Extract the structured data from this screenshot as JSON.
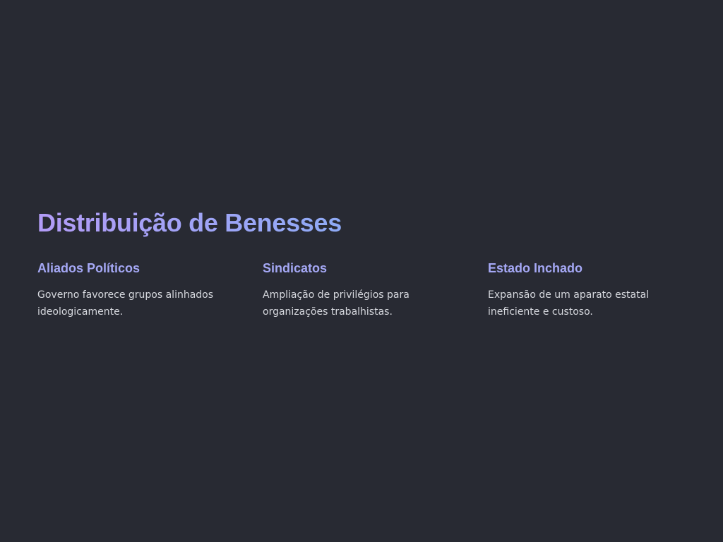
{
  "slide": {
    "title": "Distribuição de Benesses",
    "columns": [
      {
        "heading": "Aliados Políticos",
        "text": "Governo favorece grupos alinhados ideologicamente."
      },
      {
        "heading": "Sindicatos",
        "text": "Ampliação de privilégios para organizações trabalhistas."
      },
      {
        "heading": "Estado Inchado",
        "text": "Expansão de um aparato estatal ineficiente e custoso."
      }
    ]
  },
  "colors": {
    "background": "#282a33",
    "heading": "#a5a8f5",
    "body_text": "#d6d8de",
    "title_gradient_start": "#b39cf7",
    "title_gradient_mid": "#8faaf5"
  }
}
